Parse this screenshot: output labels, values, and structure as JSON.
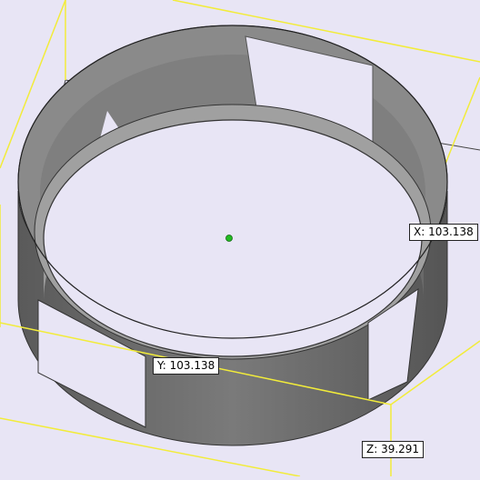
{
  "viewport": {
    "background_color": "#e8e5f5",
    "bounding_box_color": "#f2ec3a",
    "axis_color": "#444444",
    "model_color": "#808080",
    "origin_marker_color": "#22bb22"
  },
  "dimensions": {
    "x_label": "X: 103.138",
    "y_label": "Y: 103.138",
    "z_label": "Z: 39.291"
  }
}
